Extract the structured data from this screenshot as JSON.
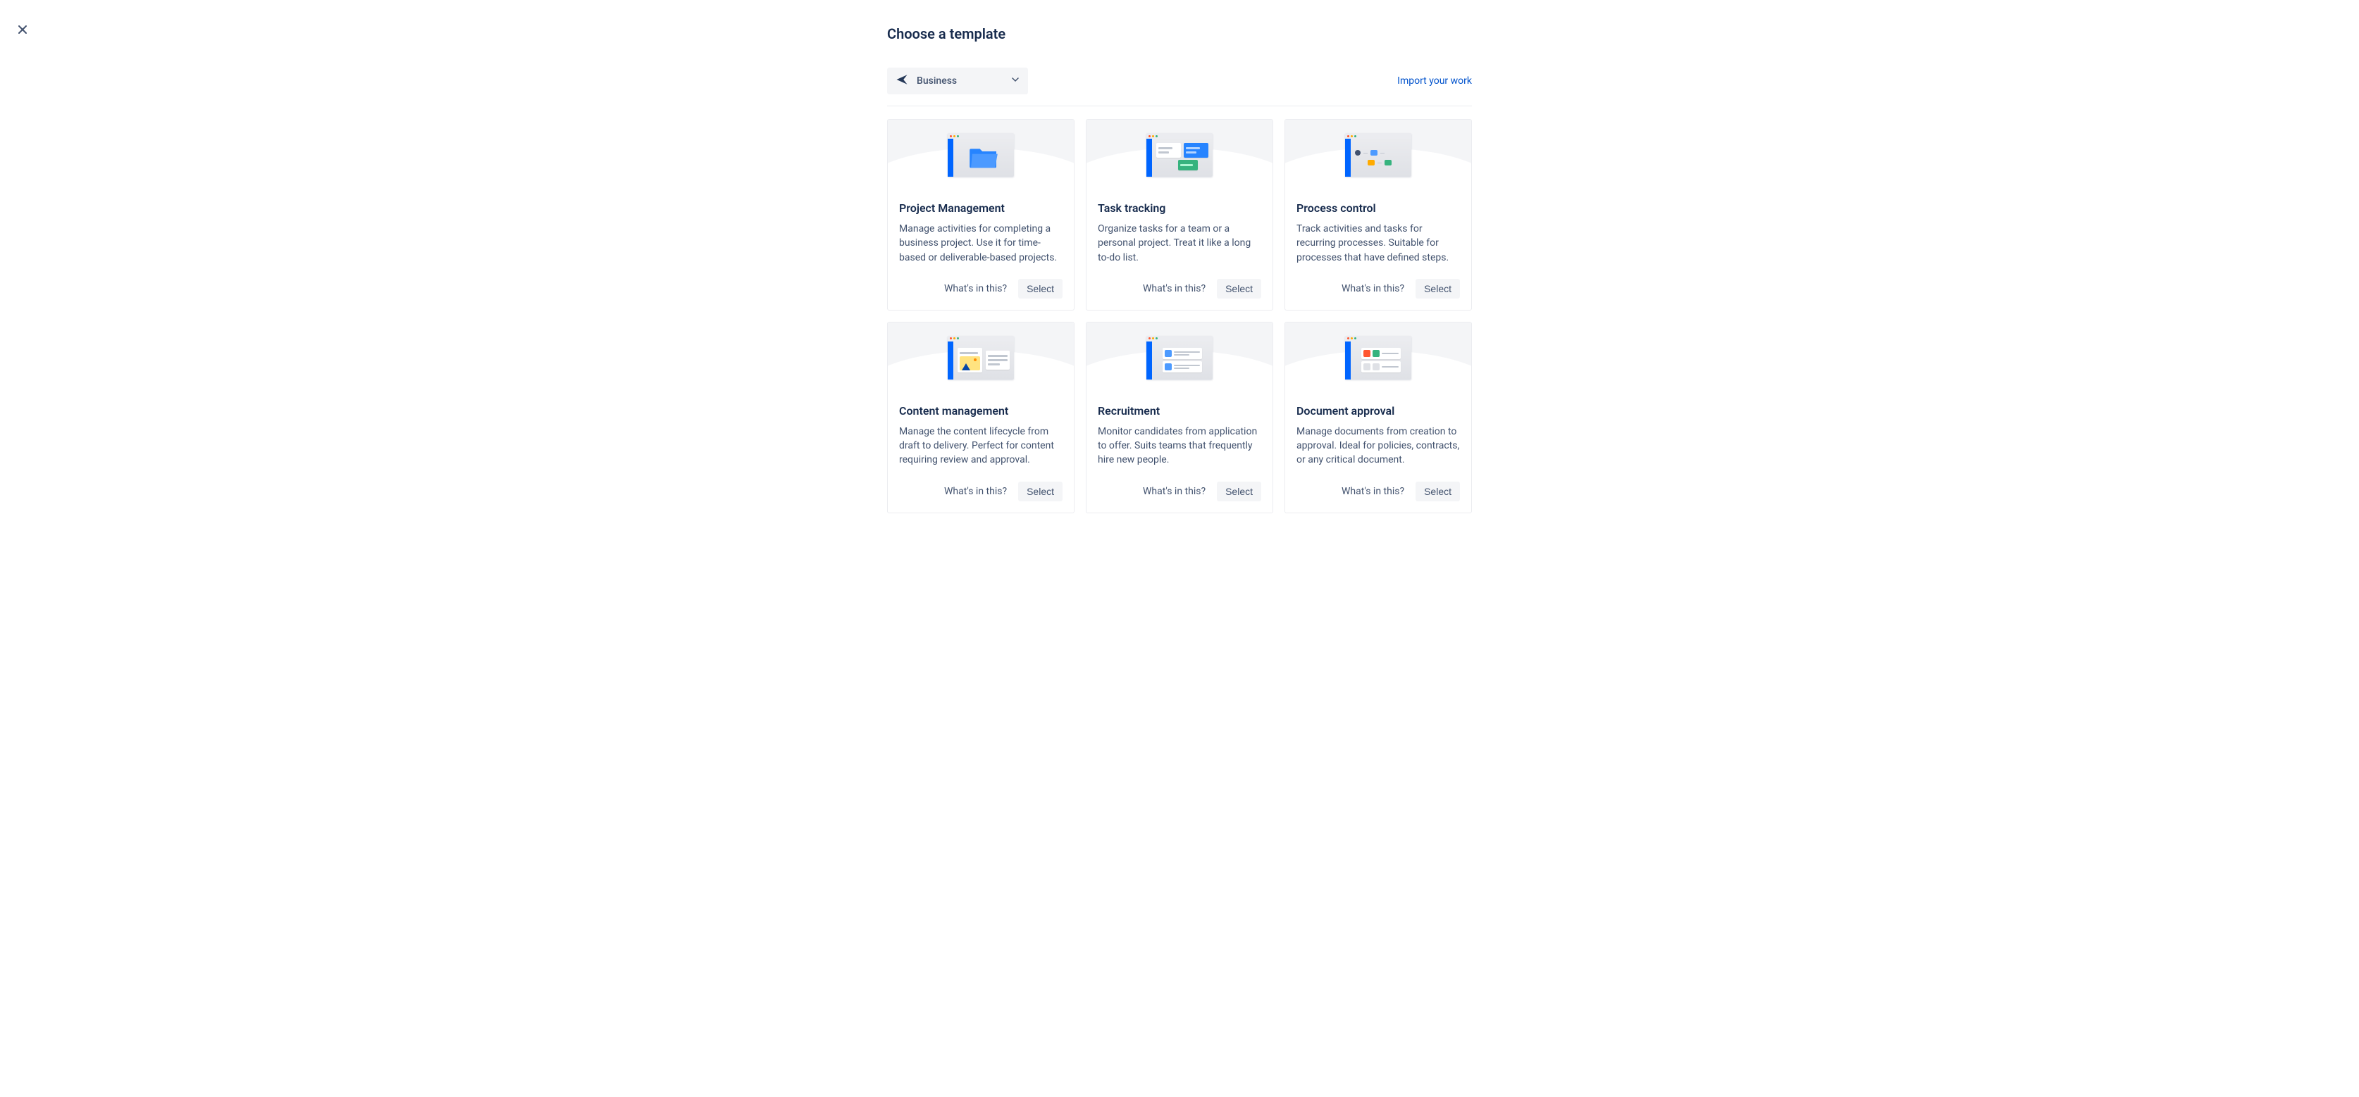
{
  "page_title": "Choose a template",
  "dropdown": {
    "selected": "Business"
  },
  "import_link": "Import your work",
  "actions": {
    "whats_in_this": "What's in this?",
    "select": "Select"
  },
  "cards": [
    {
      "title": "Project Management",
      "desc": "Manage activities for completing a business project. Use it for time-based or deliverable-based projects."
    },
    {
      "title": "Task tracking",
      "desc": "Organize tasks for a team or a personal project. Treat it like a long to-do list."
    },
    {
      "title": "Process control",
      "desc": "Track activities and tasks for recurring processes. Suitable for processes that have defined steps."
    },
    {
      "title": "Content management",
      "desc": "Manage the content lifecycle from draft to delivery. Perfect for content requiring review and approval."
    },
    {
      "title": "Recruitment",
      "desc": "Monitor candidates from application to offer. Suits teams that frequently hire new people."
    },
    {
      "title": "Document approval",
      "desc": "Manage documents from creation to approval. Ideal for policies, contracts, or any critical document."
    }
  ]
}
